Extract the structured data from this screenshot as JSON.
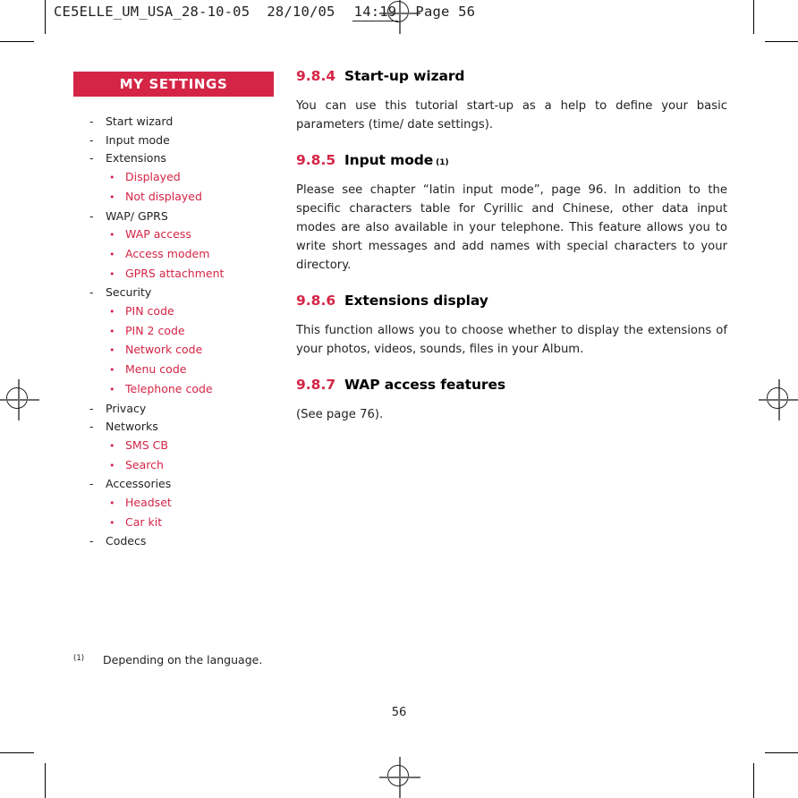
{
  "header": {
    "document_id": "CE5ELLE_UM_USA_28-10-05",
    "date": "28/10/05",
    "time": "14:19",
    "page_label": "Page 56"
  },
  "sidebar": {
    "title": "MY SETTINGS",
    "items": [
      {
        "level": 1,
        "marker": "-",
        "label": "Start wizard"
      },
      {
        "level": 1,
        "marker": "-",
        "label": "Input mode"
      },
      {
        "level": 1,
        "marker": "-",
        "label": "Extensions"
      },
      {
        "level": 2,
        "marker": "•",
        "label": "Displayed"
      },
      {
        "level": 2,
        "marker": "•",
        "label": "Not displayed"
      },
      {
        "level": 1,
        "marker": "-",
        "label": "WAP/ GPRS"
      },
      {
        "level": 2,
        "marker": "•",
        "label": "WAP access"
      },
      {
        "level": 2,
        "marker": "•",
        "label": "Access modem"
      },
      {
        "level": 2,
        "marker": "•",
        "label": "GPRS attachment"
      },
      {
        "level": 1,
        "marker": "-",
        "label": "Security"
      },
      {
        "level": 2,
        "marker": "•",
        "label": "PIN code"
      },
      {
        "level": 2,
        "marker": "•",
        "label": "PIN 2 code"
      },
      {
        "level": 2,
        "marker": "•",
        "label": "Network code"
      },
      {
        "level": 2,
        "marker": "•",
        "label": "Menu code"
      },
      {
        "level": 2,
        "marker": "•",
        "label": "Telephone code"
      },
      {
        "level": 1,
        "marker": "-",
        "label": "Privacy"
      },
      {
        "level": 1,
        "marker": "-",
        "label": "Networks"
      },
      {
        "level": 2,
        "marker": "•",
        "label": "SMS CB"
      },
      {
        "level": 2,
        "marker": "•",
        "label": "Search"
      },
      {
        "level": 1,
        "marker": "-",
        "label": "Accessories"
      },
      {
        "level": 2,
        "marker": "•",
        "label": "Headset"
      },
      {
        "level": 2,
        "marker": "•",
        "label": "Car kit"
      },
      {
        "level": 1,
        "marker": "-",
        "label": "Codecs"
      }
    ]
  },
  "main": {
    "sections": [
      {
        "number": "9.8.4",
        "title": "Start-up wizard",
        "superscript": "",
        "paragraphs": [
          "You can use this tutorial start-up as a help to define your basic parameters (time/ date settings)."
        ]
      },
      {
        "number": "9.8.5",
        "title": "Input mode",
        "superscript": "(1)",
        "paragraphs": [
          "Please see chapter “latin input mode”, page 96. In addition to the specific characters table for Cyrillic and Chinese, other data input modes are also available in your telephone. This feature allows you to write short messages and add names with special characters to your directory."
        ]
      },
      {
        "number": "9.8.6",
        "title": "Extensions display",
        "superscript": "",
        "paragraphs": [
          "This function allows you to choose whether to display the extensions of your photos, videos, sounds, files in your Album."
        ]
      },
      {
        "number": "9.8.7",
        "title": "WAP access features",
        "superscript": "",
        "paragraphs": [
          "(See page 76)."
        ]
      }
    ]
  },
  "footnote": {
    "marker": "(1)",
    "text": "Depending on the language."
  },
  "folio": {
    "page_number": "56"
  },
  "colors": {
    "accent_red": "#d42546",
    "text": "#231f20"
  }
}
